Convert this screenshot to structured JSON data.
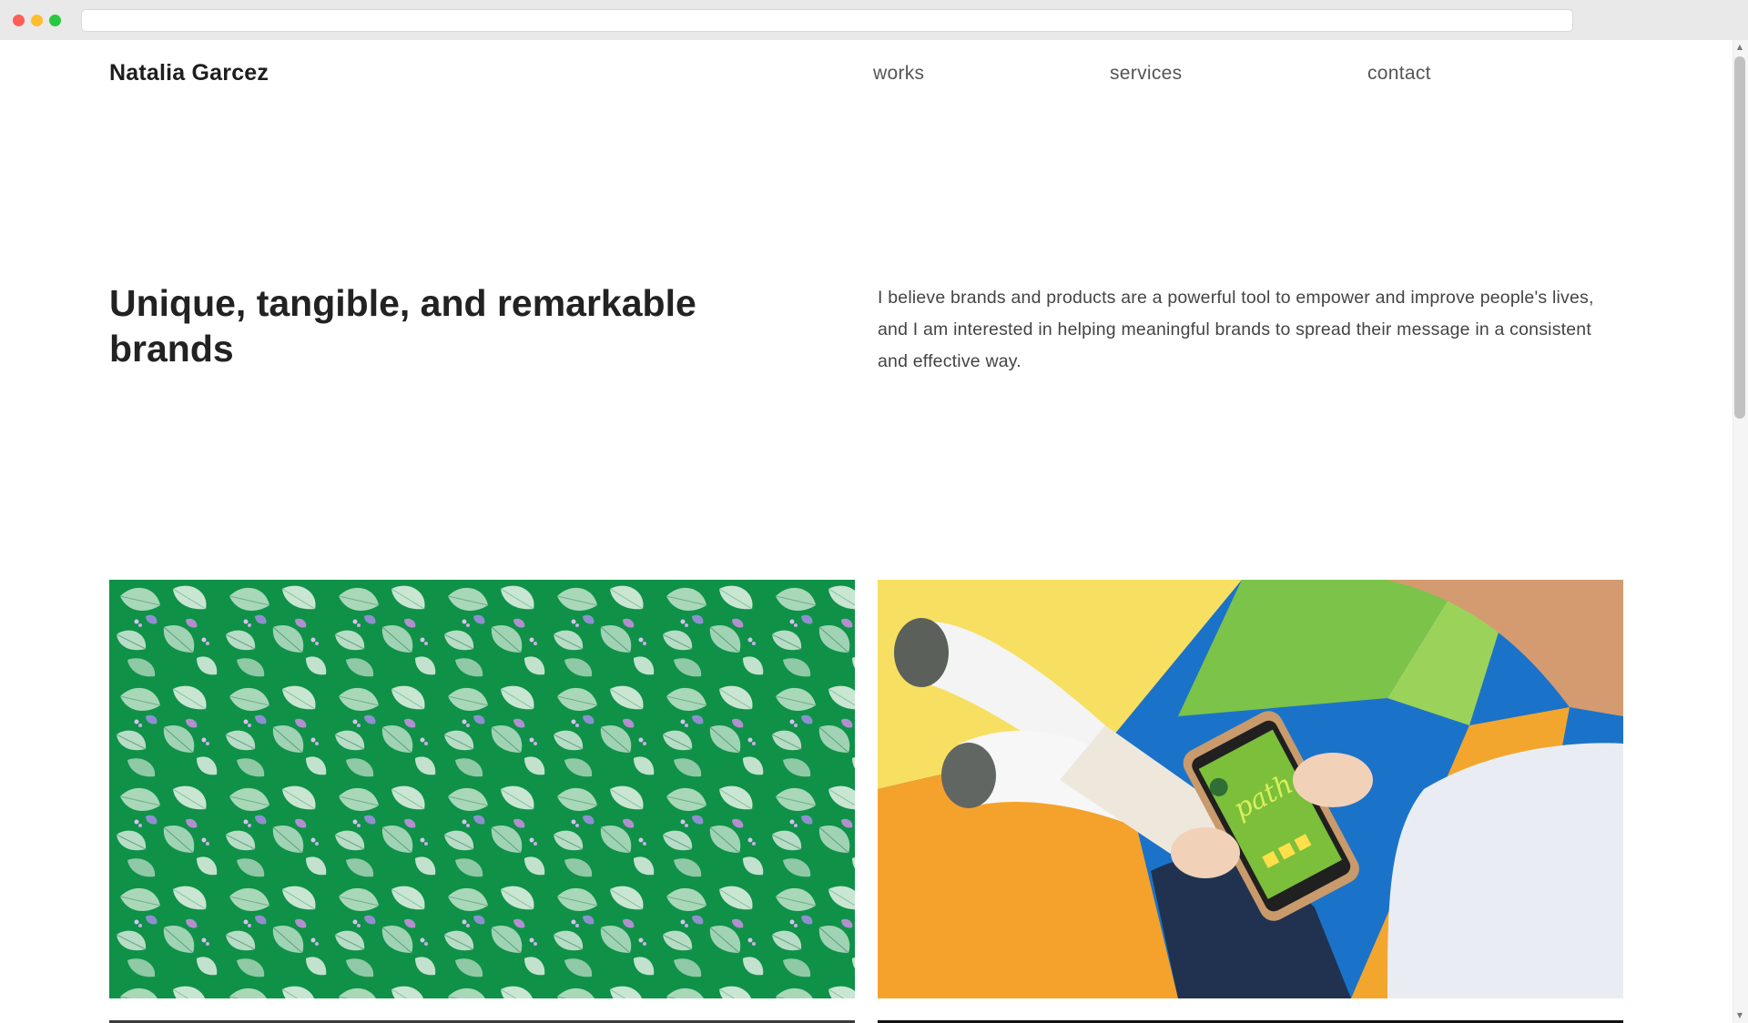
{
  "header": {
    "brand": "Natalia Garcez",
    "nav": [
      {
        "label": "works"
      },
      {
        "label": "services"
      },
      {
        "label": "contact"
      }
    ]
  },
  "hero": {
    "title": "Unique, tangible, and remarkable brands",
    "description": "I believe brands and products are a powerful tool to empower and improve people's lives, and I am interested in helping meaningful brands to spread their message in a consistent and effective way."
  },
  "works": [
    {
      "name": "leaf-pattern-project",
      "image": "green leaf pattern illustration"
    },
    {
      "name": "path-app-project",
      "image": "child holding smartphone with path app",
      "app_text": "path"
    }
  ],
  "colors": {
    "leaf_green": "#0f9148",
    "yellow": "#f7c23a",
    "blue": "#1b73c9",
    "orange": "#f4a22c"
  }
}
